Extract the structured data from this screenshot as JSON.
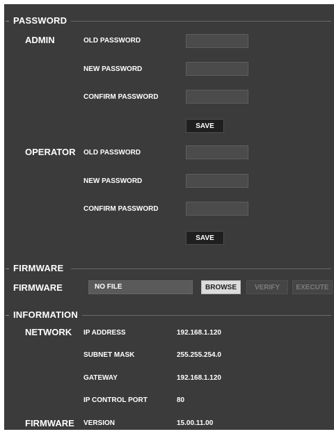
{
  "password": {
    "section_title": "PASSWORD",
    "admin": {
      "label": "ADMIN",
      "old_label": "OLD PASSWORD",
      "new_label": "NEW PASSWORD",
      "confirm_label": "CONFIRM PASSWORD",
      "save_label": "SAVE"
    },
    "operator": {
      "label": "OPERATOR",
      "old_label": "OLD PASSWORD",
      "new_label": "NEW PASSWORD",
      "confirm_label": "CONFIRM PASSWORD",
      "save_label": "SAVE"
    }
  },
  "firmware": {
    "section_title": "FIRMWARE",
    "label": "FIRMWARE",
    "file_value": "NO FILE",
    "browse_label": "BROWSE",
    "verify_label": "VERIFY",
    "execute_label": "EXECUTE"
  },
  "information": {
    "section_title": "INFORMATION",
    "network": {
      "label": "NETWORK",
      "ip_label": "IP ADDRESS",
      "ip_value": "192.168.1.120",
      "subnet_label": "SUBNET MASK",
      "subnet_value": "255.255.254.0",
      "gateway_label": "GATEWAY",
      "gateway_value": "192.168.1.120",
      "port_label": "IP CONTROL PORT",
      "port_value": "80"
    },
    "firmware": {
      "label": "FIRMWARE",
      "version_label": "VERSION",
      "version_value": "15.00.11.00"
    }
  },
  "colors": {
    "panel_bg": "#3b3b3b",
    "text": "#ffffff",
    "button_dark": "#1f1f1f",
    "button_light": "#dcdcdc",
    "disabled_text": "#7c7c7c"
  }
}
